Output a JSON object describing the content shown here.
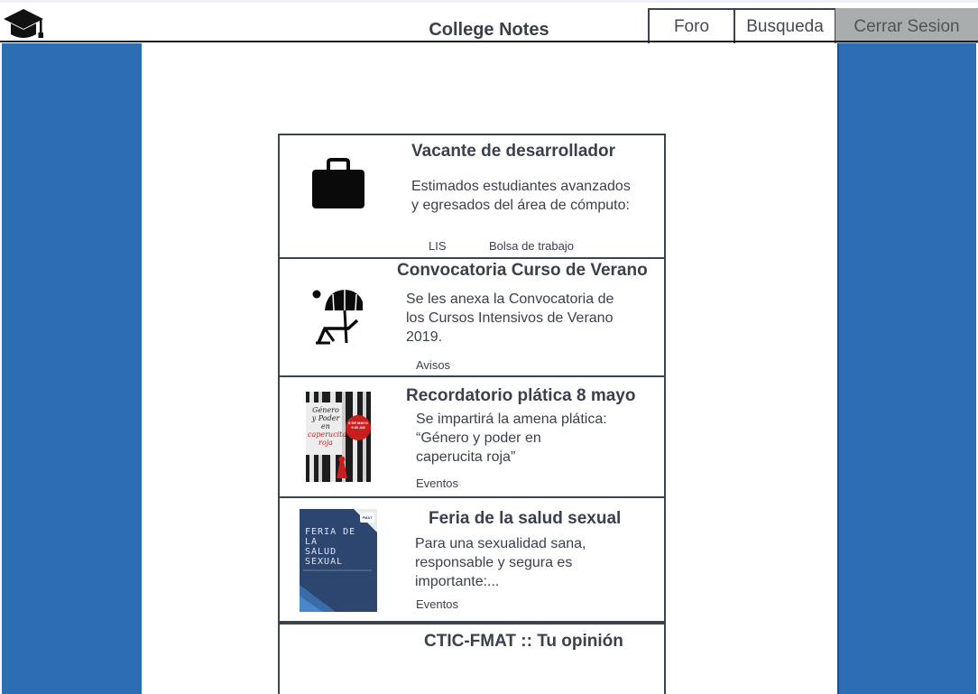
{
  "header": {
    "title": "College Notes",
    "nav": {
      "foro": "Foro",
      "busqueda": "Busqueda",
      "cerrar_sesion": "Cerrar Sesion"
    }
  },
  "colors": {
    "side_panel": "#2c6db3",
    "logout_button": "#a9adad",
    "border": "#3b4350"
  },
  "feed": [
    {
      "title": "Vacante de desarrollador",
      "body_lines": [
        "Estimados estudiantes avanzados",
        "y egresados del área de cómputo:"
      ],
      "tags": [
        "LIS",
        "Bolsa de trabajo"
      ],
      "icon": "briefcase-icon"
    },
    {
      "title": "Convocatoria Curso de Verano",
      "body_lines": [
        "Se les anexa la Convocatoria de",
        "los Cursos Intensivos de Verano",
        "2019."
      ],
      "tags": [
        "Avisos"
      ],
      "icon": "beach-umbrella-icon"
    },
    {
      "title": "Recordatorio plática 8 mayo",
      "body_lines": [
        "Se impartirá la amena plática:",
        "“Género y poder en",
        "caperucita roja”"
      ],
      "tags": [
        "Eventos"
      ],
      "image": {
        "line1": "Género",
        "line2": "y Poder",
        "line3": "en",
        "line4": "caperucita",
        "line5": "roja",
        "side1": "8 DE MAYO",
        "side2": "9:30 AM"
      }
    },
    {
      "title": "Feria de la salud sexual",
      "body_lines": [
        "Para una sexualidad sana,",
        "responsable y segura es",
        "importante:..."
      ],
      "tags": [
        "Eventos"
      ],
      "image": {
        "line1": "FERIA DE",
        "line2": "LA",
        "line3": "SALUD",
        "line4": "SEXUAL",
        "badge": "FMAT"
      }
    },
    {
      "title": "CTIC-FMAT :: Tu opinión",
      "body_lines": [],
      "tags": []
    }
  ]
}
